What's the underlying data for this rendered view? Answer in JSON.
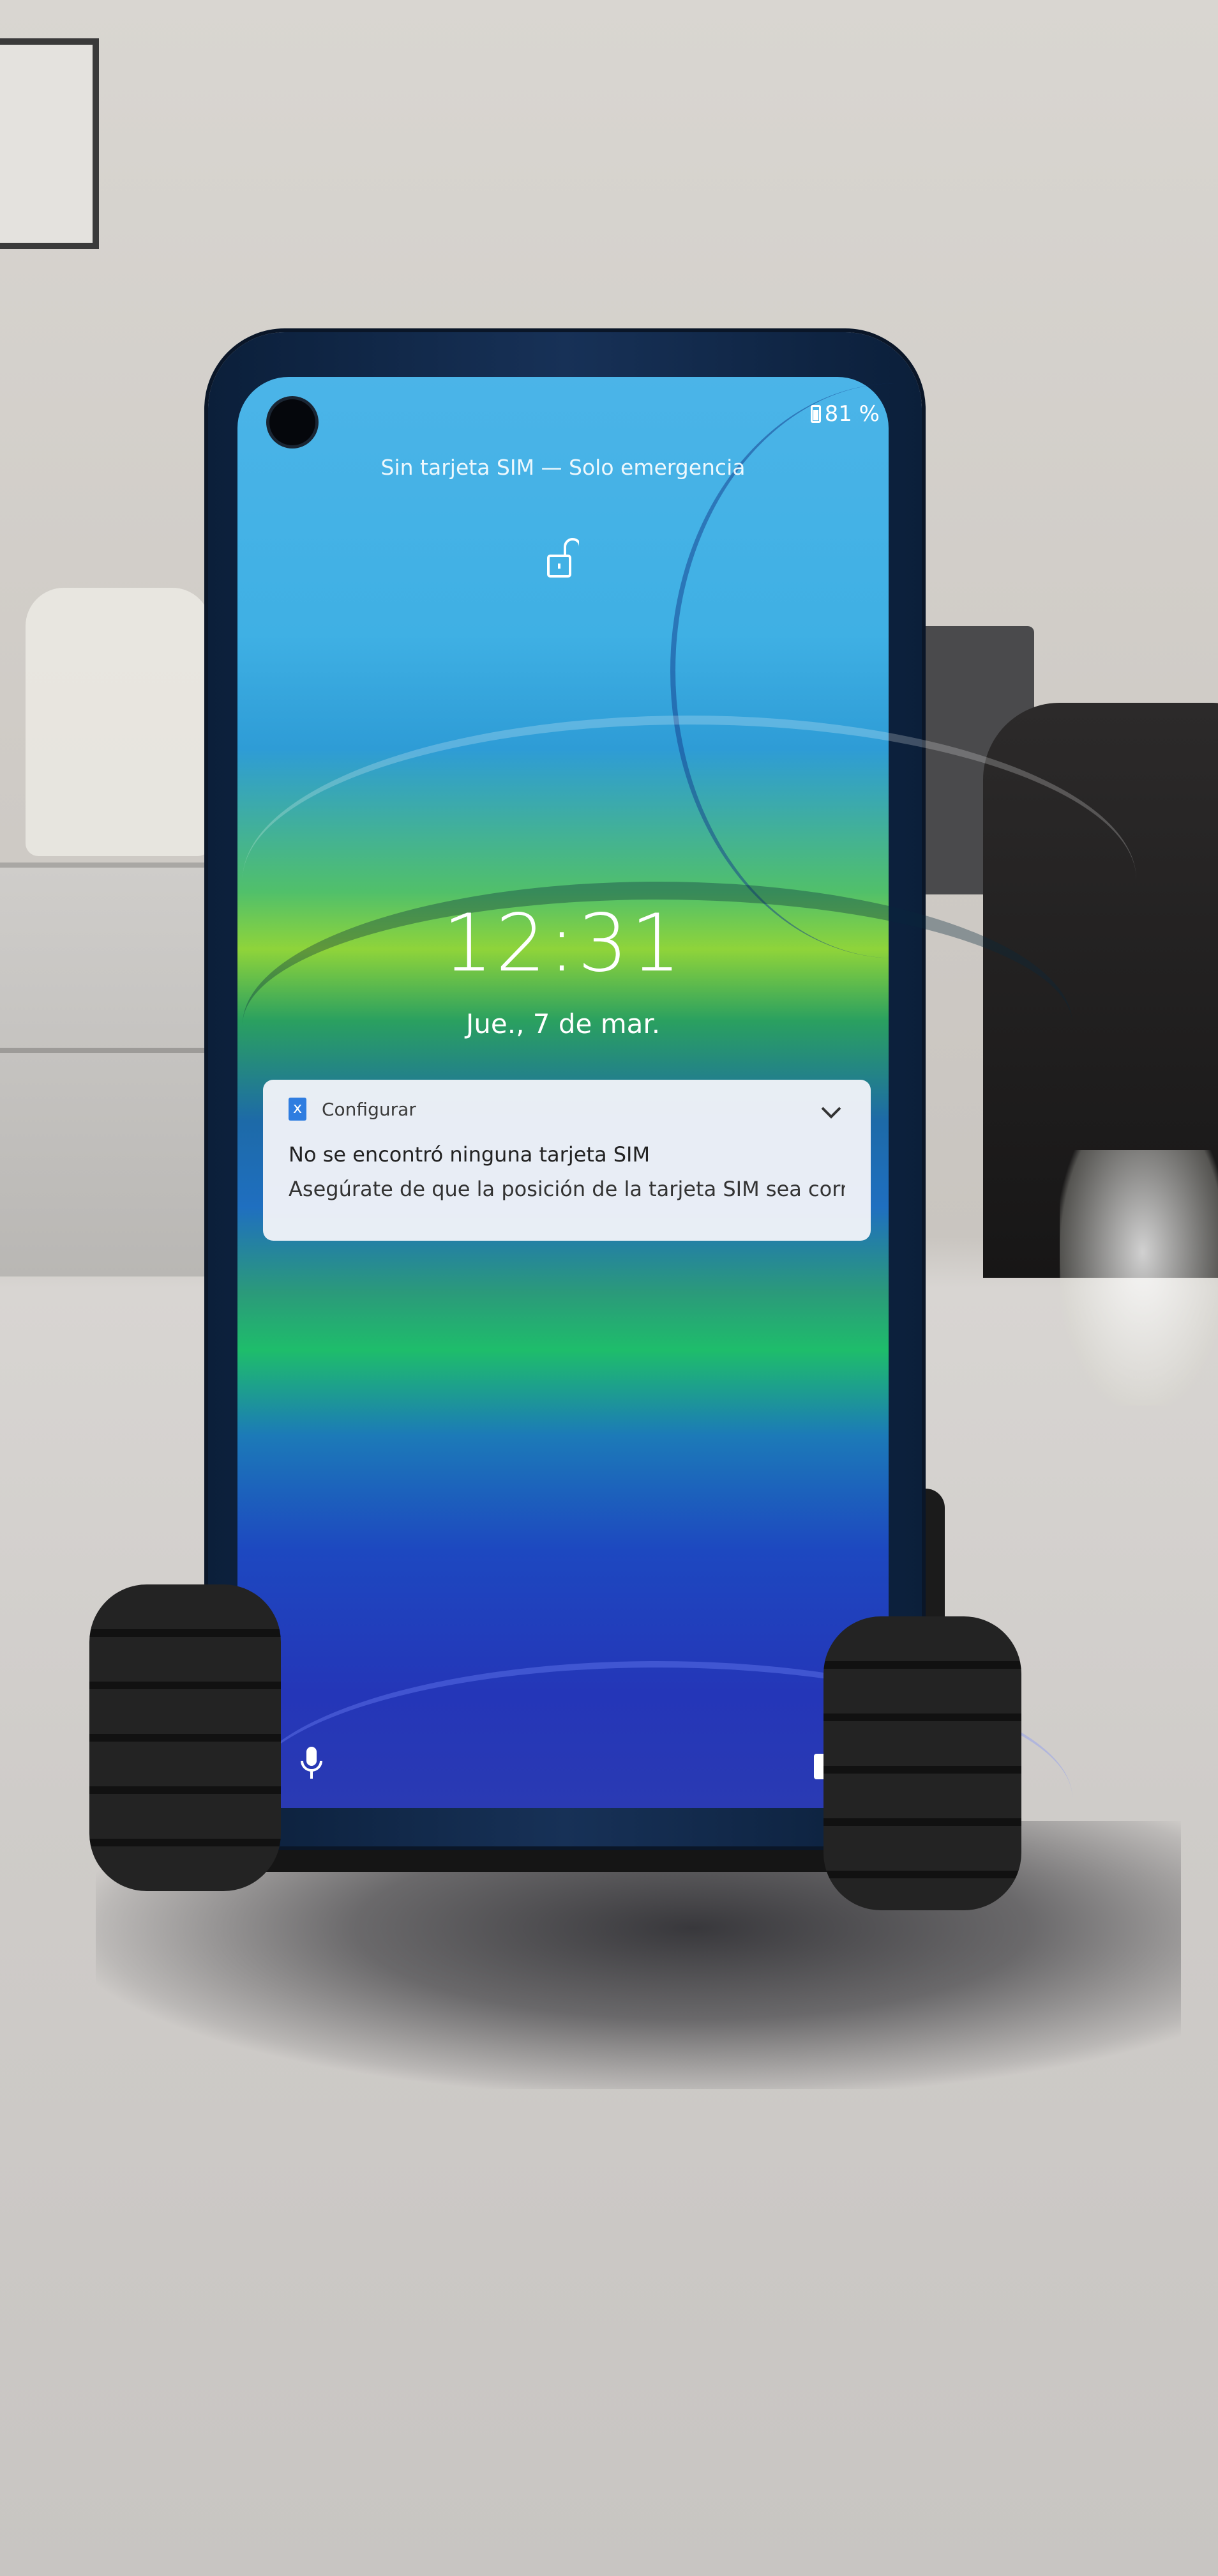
{
  "status_bar": {
    "battery_percent": "81 %",
    "battery_icon": "battery-icon"
  },
  "lock_screen": {
    "carrier_status": "Sin tarjeta SIM — Solo emergencia",
    "lock_icon": "unlocked-padlock-icon",
    "time": "12:31",
    "date": "Jue., 7 de mar."
  },
  "notification": {
    "app_name": "Configurar",
    "app_icon": "sim-card-icon",
    "title": "No se encontró ninguna tarjeta SIM",
    "body": "Asegúrate de que la posición de la tarjeta SIM sea correct..",
    "expand_icon": "chevron-down-icon"
  },
  "shortcuts": {
    "left": "microphone-icon",
    "right": "camera-icon"
  },
  "colors": {
    "phone_frame": "#173157",
    "notification_bg": "#f0f3f8",
    "sim_icon": "#2f7de0"
  }
}
